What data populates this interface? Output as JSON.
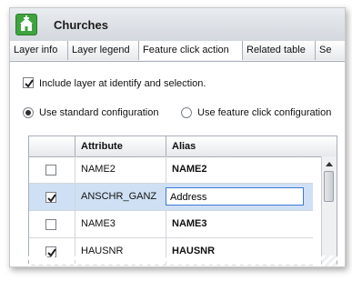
{
  "window": {
    "title": "Churches",
    "icon": "church-layer-icon"
  },
  "tabs": [
    {
      "label": "Layer info"
    },
    {
      "label": "Layer legend"
    },
    {
      "label": "Feature click action"
    },
    {
      "label": "Related table"
    },
    {
      "label": "Se"
    }
  ],
  "options": {
    "include_label": "Include layer at identify and selection.",
    "include_checked": true,
    "radio_standard": "Use standard configuration",
    "radio_feature": "Use feature click configuration",
    "selected_radio": "standard"
  },
  "grid": {
    "columns": [
      "",
      "Attribute",
      "Alias"
    ],
    "rows": [
      {
        "checked": false,
        "attribute": "NAME2",
        "alias": "NAME2",
        "editing": false
      },
      {
        "checked": true,
        "attribute": "ANSCHR_GANZ",
        "alias": "Address",
        "editing": true
      },
      {
        "checked": false,
        "attribute": "NAME3",
        "alias": "NAME3",
        "editing": false
      },
      {
        "checked": true,
        "attribute": "HAUSNR",
        "alias": "HAUSNR",
        "editing": false
      }
    ]
  }
}
